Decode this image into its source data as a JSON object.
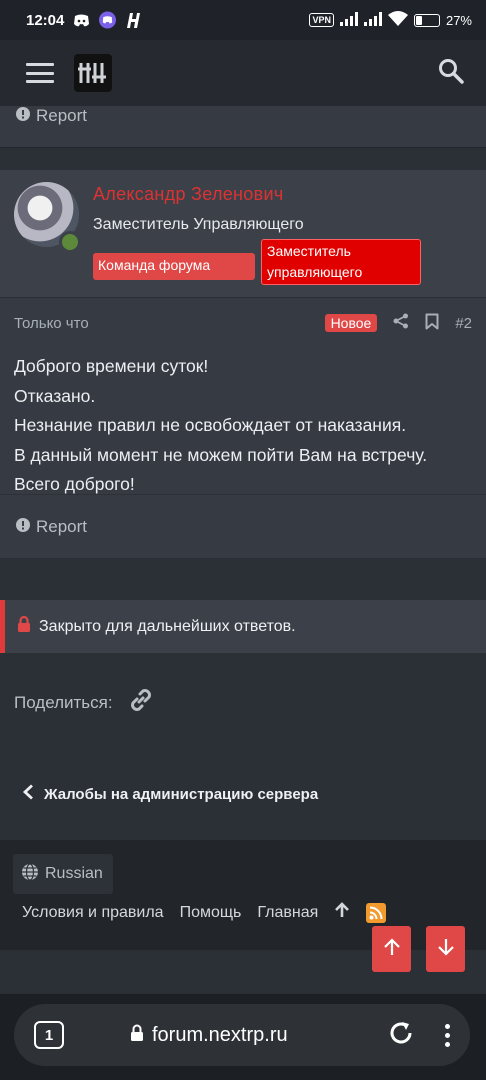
{
  "status_bar": {
    "time": "12:04",
    "vpn": "VPN",
    "battery": "27%",
    "battery_level": 0.27
  },
  "top_post": {
    "report_label": "Report"
  },
  "post": {
    "username": "Александр Зеленович",
    "user_title": "Заместитель Управляющего",
    "badges": [
      "Команда форума",
      "Заместитель управляющего"
    ],
    "time": "Только что",
    "new_label": "Новое",
    "number": "#2",
    "body": [
      "Доброго времени суток!",
      "Отказано.",
      "Незнание правил не освобождает от наказания.",
      "В данный момент не можем пойти Вам на встречу.",
      "Всего доброго!"
    ],
    "report_label": "Report"
  },
  "closed_notice": "Закрыто для дальнейших ответов.",
  "share_label": "Поделиться:",
  "back_link": "Жалобы на администрацию сервера",
  "footer": {
    "language": "Russian",
    "links": [
      "Условия и правила",
      "Помощь",
      "Главная"
    ]
  },
  "browser": {
    "tab_count": "1",
    "url": "forum.nextrp.ru"
  },
  "colors": {
    "accent_red": "#e04848",
    "username_red": "#e03131",
    "background": "#2b2f36"
  }
}
